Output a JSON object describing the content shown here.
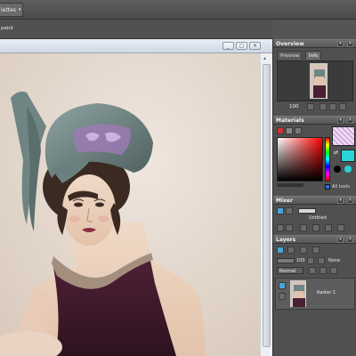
{
  "topbar": {
    "palettes_label": "lettes"
  },
  "toolbar": {
    "tool_name": "paint"
  },
  "document": {
    "window_buttons": [
      "_",
      "□",
      "✕"
    ]
  },
  "overview": {
    "title": "Overview",
    "tabs": [
      "Preview",
      "Info"
    ],
    "zoom_value": "100"
  },
  "materials": {
    "title": "Materials",
    "all_tools_label": "All tools"
  },
  "mixer": {
    "title": "Mixer",
    "preset_name": "Untitled"
  },
  "layers": {
    "title": "Layers",
    "opacity_value": "100",
    "blend_mode": "Normal",
    "blend_none": "None",
    "layer_name": "Raster 1"
  },
  "colors": {
    "panel_bg": "#4e4e4e",
    "accent_cyan": "#29d3d8",
    "canvas_bg": "#e7dcd3",
    "titlebar": "#dfe6ef"
  }
}
